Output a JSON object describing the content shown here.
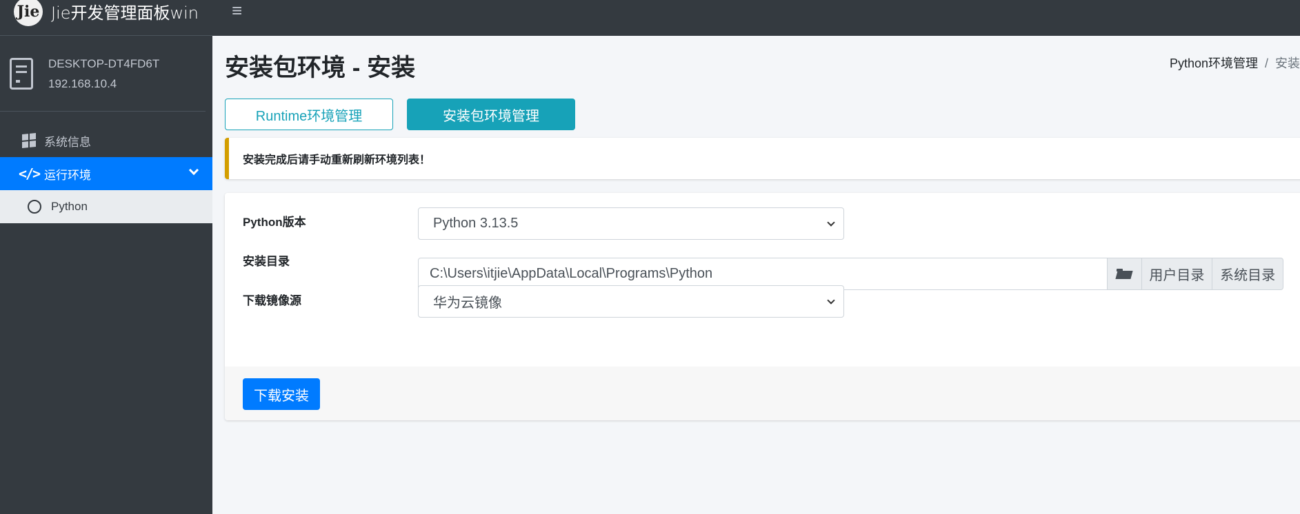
{
  "brand": {
    "logo_text": "Jie",
    "title": "Jie开发管理面板win"
  },
  "topbar": {
    "menu_icon": "hamburger-icon",
    "menu_glyph": "≡"
  },
  "user_panel": {
    "hostname": "DESKTOP-DT4FD6T",
    "ip": "192.168.10.4",
    "icon": "server-icon"
  },
  "sidebar": {
    "items": [
      {
        "label": "系统信息",
        "icon": "windows-icon",
        "active": false
      },
      {
        "label": "运行环境",
        "icon": "code-icon",
        "active": true,
        "expanded": true
      },
      {
        "label": "Python",
        "icon": "circle-icon",
        "sub": true
      }
    ]
  },
  "page": {
    "title": "安装包环境 - 安装",
    "breadcrumb": [
      "Python环境管理",
      "安装"
    ],
    "breadcrumb_sep": "/"
  },
  "tabs": {
    "runtime_label": "Runtime环境管理",
    "package_label": "安装包环境管理"
  },
  "callout": {
    "text": "安装完成后请手动重新刷新环境列表！"
  },
  "form": {
    "version_label": "Python版本",
    "version_value": "Python 3.13.5",
    "dir_label": "安装目录",
    "dir_value": "C:\\Users\\itjie\\AppData\\Local\\Programs\\Python",
    "user_dir_button": "用户目录",
    "system_dir_button": "系统目录",
    "mirror_label": "下载镜像源",
    "mirror_value": "华为云镜像",
    "submit_label": "下载安装"
  },
  "colors": {
    "sidebar_bg": "#343a40",
    "active": "#007bff",
    "info": "#17a2b8",
    "warning": "#d39e00"
  }
}
